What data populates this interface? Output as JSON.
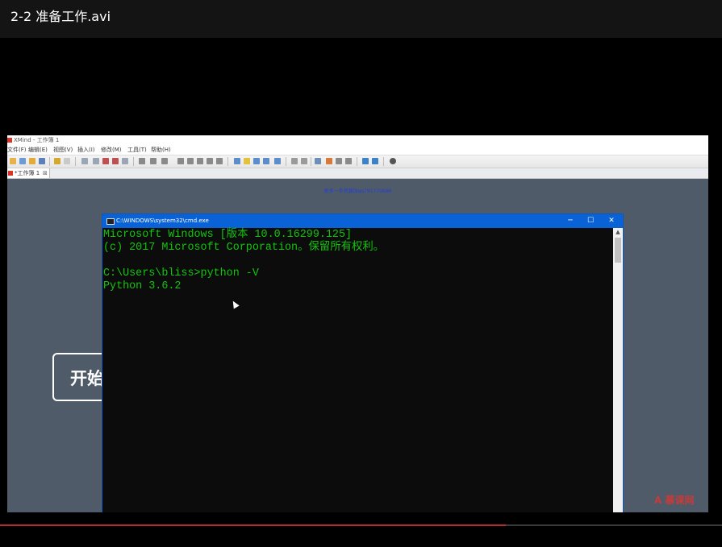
{
  "player": {
    "title": "2-2 准备工作.avi",
    "progress": 0.7
  },
  "xmind": {
    "window_title": "XMind - 工作簿 1",
    "menu": [
      "文件(F)",
      "编辑(E)",
      "视图(V)",
      "插入(I)",
      "修改(M)",
      "工具(T)",
      "帮助(H)"
    ],
    "tab_label": "*工作簿 1",
    "tab_close": "⊠",
    "canvas_link": "更多一手资源加qq791770686",
    "topic_label": "开始",
    "watermark": "A 慕课网",
    "colors": {
      "canvas": "#4f5b68",
      "toolbar": "#ececec"
    }
  },
  "cmd": {
    "title": "C:\\WINDOWS\\system32\\cmd.exe",
    "minimize": "─",
    "maximize": "☐",
    "close": "✕",
    "lines": [
      "Microsoft Windows [版本 10.0.16299.125]",
      "(c) 2017 Microsoft Corporation。保留所有权利。",
      "",
      "C:\\Users\\bliss>python -V",
      "Python 3.6.2"
    ],
    "colors": {
      "text": "#13c40d",
      "titlebar": "#0a63d6"
    }
  }
}
